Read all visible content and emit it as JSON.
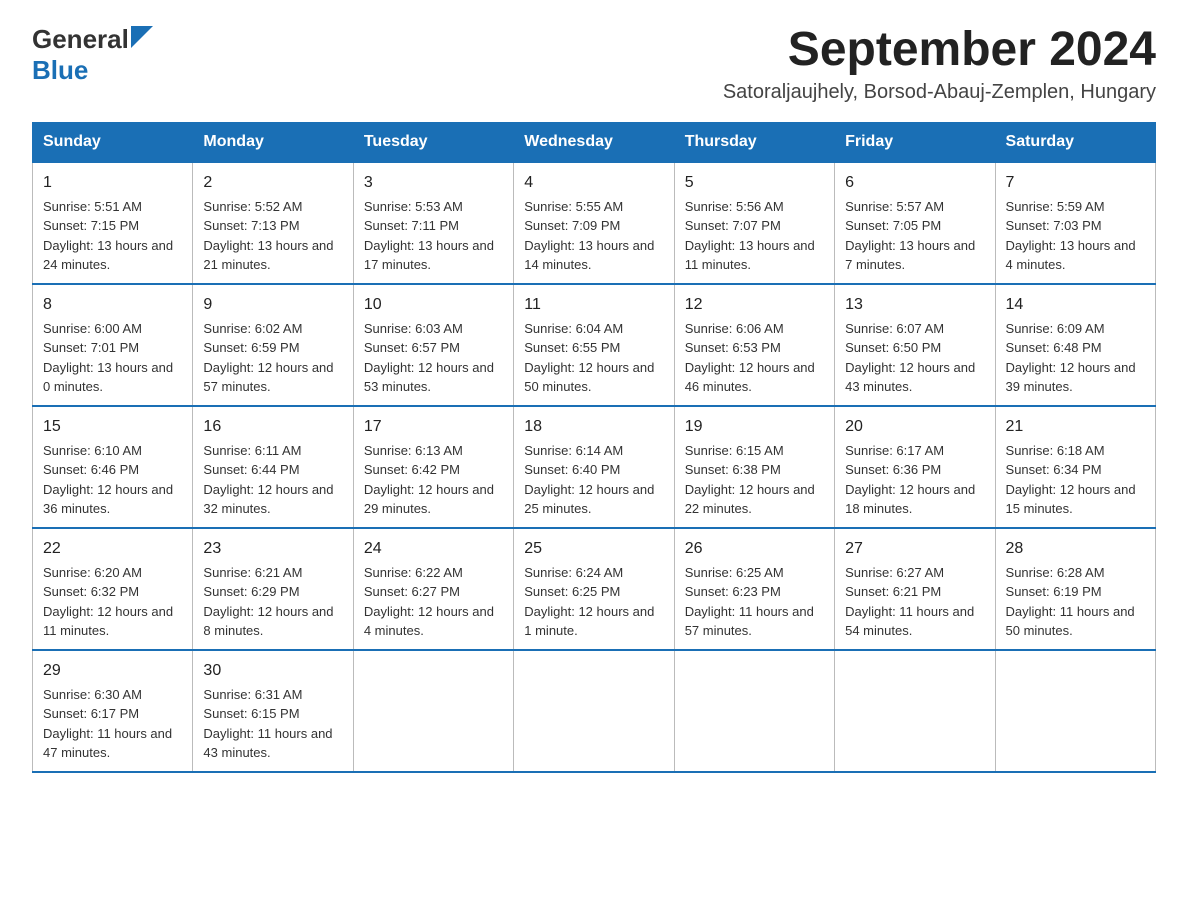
{
  "header": {
    "logo_general": "General",
    "logo_blue": "Blue",
    "month_title": "September 2024",
    "location": "Satoraljaujhely, Borsod-Abauj-Zemplen, Hungary"
  },
  "weekdays": [
    "Sunday",
    "Monday",
    "Tuesday",
    "Wednesday",
    "Thursday",
    "Friday",
    "Saturday"
  ],
  "weeks": [
    [
      {
        "day": "1",
        "sunrise": "5:51 AM",
        "sunset": "7:15 PM",
        "daylight": "13 hours and 24 minutes."
      },
      {
        "day": "2",
        "sunrise": "5:52 AM",
        "sunset": "7:13 PM",
        "daylight": "13 hours and 21 minutes."
      },
      {
        "day": "3",
        "sunrise": "5:53 AM",
        "sunset": "7:11 PM",
        "daylight": "13 hours and 17 minutes."
      },
      {
        "day": "4",
        "sunrise": "5:55 AM",
        "sunset": "7:09 PM",
        "daylight": "13 hours and 14 minutes."
      },
      {
        "day": "5",
        "sunrise": "5:56 AM",
        "sunset": "7:07 PM",
        "daylight": "13 hours and 11 minutes."
      },
      {
        "day": "6",
        "sunrise": "5:57 AM",
        "sunset": "7:05 PM",
        "daylight": "13 hours and 7 minutes."
      },
      {
        "day": "7",
        "sunrise": "5:59 AM",
        "sunset": "7:03 PM",
        "daylight": "13 hours and 4 minutes."
      }
    ],
    [
      {
        "day": "8",
        "sunrise": "6:00 AM",
        "sunset": "7:01 PM",
        "daylight": "13 hours and 0 minutes."
      },
      {
        "day": "9",
        "sunrise": "6:02 AM",
        "sunset": "6:59 PM",
        "daylight": "12 hours and 57 minutes."
      },
      {
        "day": "10",
        "sunrise": "6:03 AM",
        "sunset": "6:57 PM",
        "daylight": "12 hours and 53 minutes."
      },
      {
        "day": "11",
        "sunrise": "6:04 AM",
        "sunset": "6:55 PM",
        "daylight": "12 hours and 50 minutes."
      },
      {
        "day": "12",
        "sunrise": "6:06 AM",
        "sunset": "6:53 PM",
        "daylight": "12 hours and 46 minutes."
      },
      {
        "day": "13",
        "sunrise": "6:07 AM",
        "sunset": "6:50 PM",
        "daylight": "12 hours and 43 minutes."
      },
      {
        "day": "14",
        "sunrise": "6:09 AM",
        "sunset": "6:48 PM",
        "daylight": "12 hours and 39 minutes."
      }
    ],
    [
      {
        "day": "15",
        "sunrise": "6:10 AM",
        "sunset": "6:46 PM",
        "daylight": "12 hours and 36 minutes."
      },
      {
        "day": "16",
        "sunrise": "6:11 AM",
        "sunset": "6:44 PM",
        "daylight": "12 hours and 32 minutes."
      },
      {
        "day": "17",
        "sunrise": "6:13 AM",
        "sunset": "6:42 PM",
        "daylight": "12 hours and 29 minutes."
      },
      {
        "day": "18",
        "sunrise": "6:14 AM",
        "sunset": "6:40 PM",
        "daylight": "12 hours and 25 minutes."
      },
      {
        "day": "19",
        "sunrise": "6:15 AM",
        "sunset": "6:38 PM",
        "daylight": "12 hours and 22 minutes."
      },
      {
        "day": "20",
        "sunrise": "6:17 AM",
        "sunset": "6:36 PM",
        "daylight": "12 hours and 18 minutes."
      },
      {
        "day": "21",
        "sunrise": "6:18 AM",
        "sunset": "6:34 PM",
        "daylight": "12 hours and 15 minutes."
      }
    ],
    [
      {
        "day": "22",
        "sunrise": "6:20 AM",
        "sunset": "6:32 PM",
        "daylight": "12 hours and 11 minutes."
      },
      {
        "day": "23",
        "sunrise": "6:21 AM",
        "sunset": "6:29 PM",
        "daylight": "12 hours and 8 minutes."
      },
      {
        "day": "24",
        "sunrise": "6:22 AM",
        "sunset": "6:27 PM",
        "daylight": "12 hours and 4 minutes."
      },
      {
        "day": "25",
        "sunrise": "6:24 AM",
        "sunset": "6:25 PM",
        "daylight": "12 hours and 1 minute."
      },
      {
        "day": "26",
        "sunrise": "6:25 AM",
        "sunset": "6:23 PM",
        "daylight": "11 hours and 57 minutes."
      },
      {
        "day": "27",
        "sunrise": "6:27 AM",
        "sunset": "6:21 PM",
        "daylight": "11 hours and 54 minutes."
      },
      {
        "day": "28",
        "sunrise": "6:28 AM",
        "sunset": "6:19 PM",
        "daylight": "11 hours and 50 minutes."
      }
    ],
    [
      {
        "day": "29",
        "sunrise": "6:30 AM",
        "sunset": "6:17 PM",
        "daylight": "11 hours and 47 minutes."
      },
      {
        "day": "30",
        "sunrise": "6:31 AM",
        "sunset": "6:15 PM",
        "daylight": "11 hours and 43 minutes."
      },
      null,
      null,
      null,
      null,
      null
    ]
  ]
}
